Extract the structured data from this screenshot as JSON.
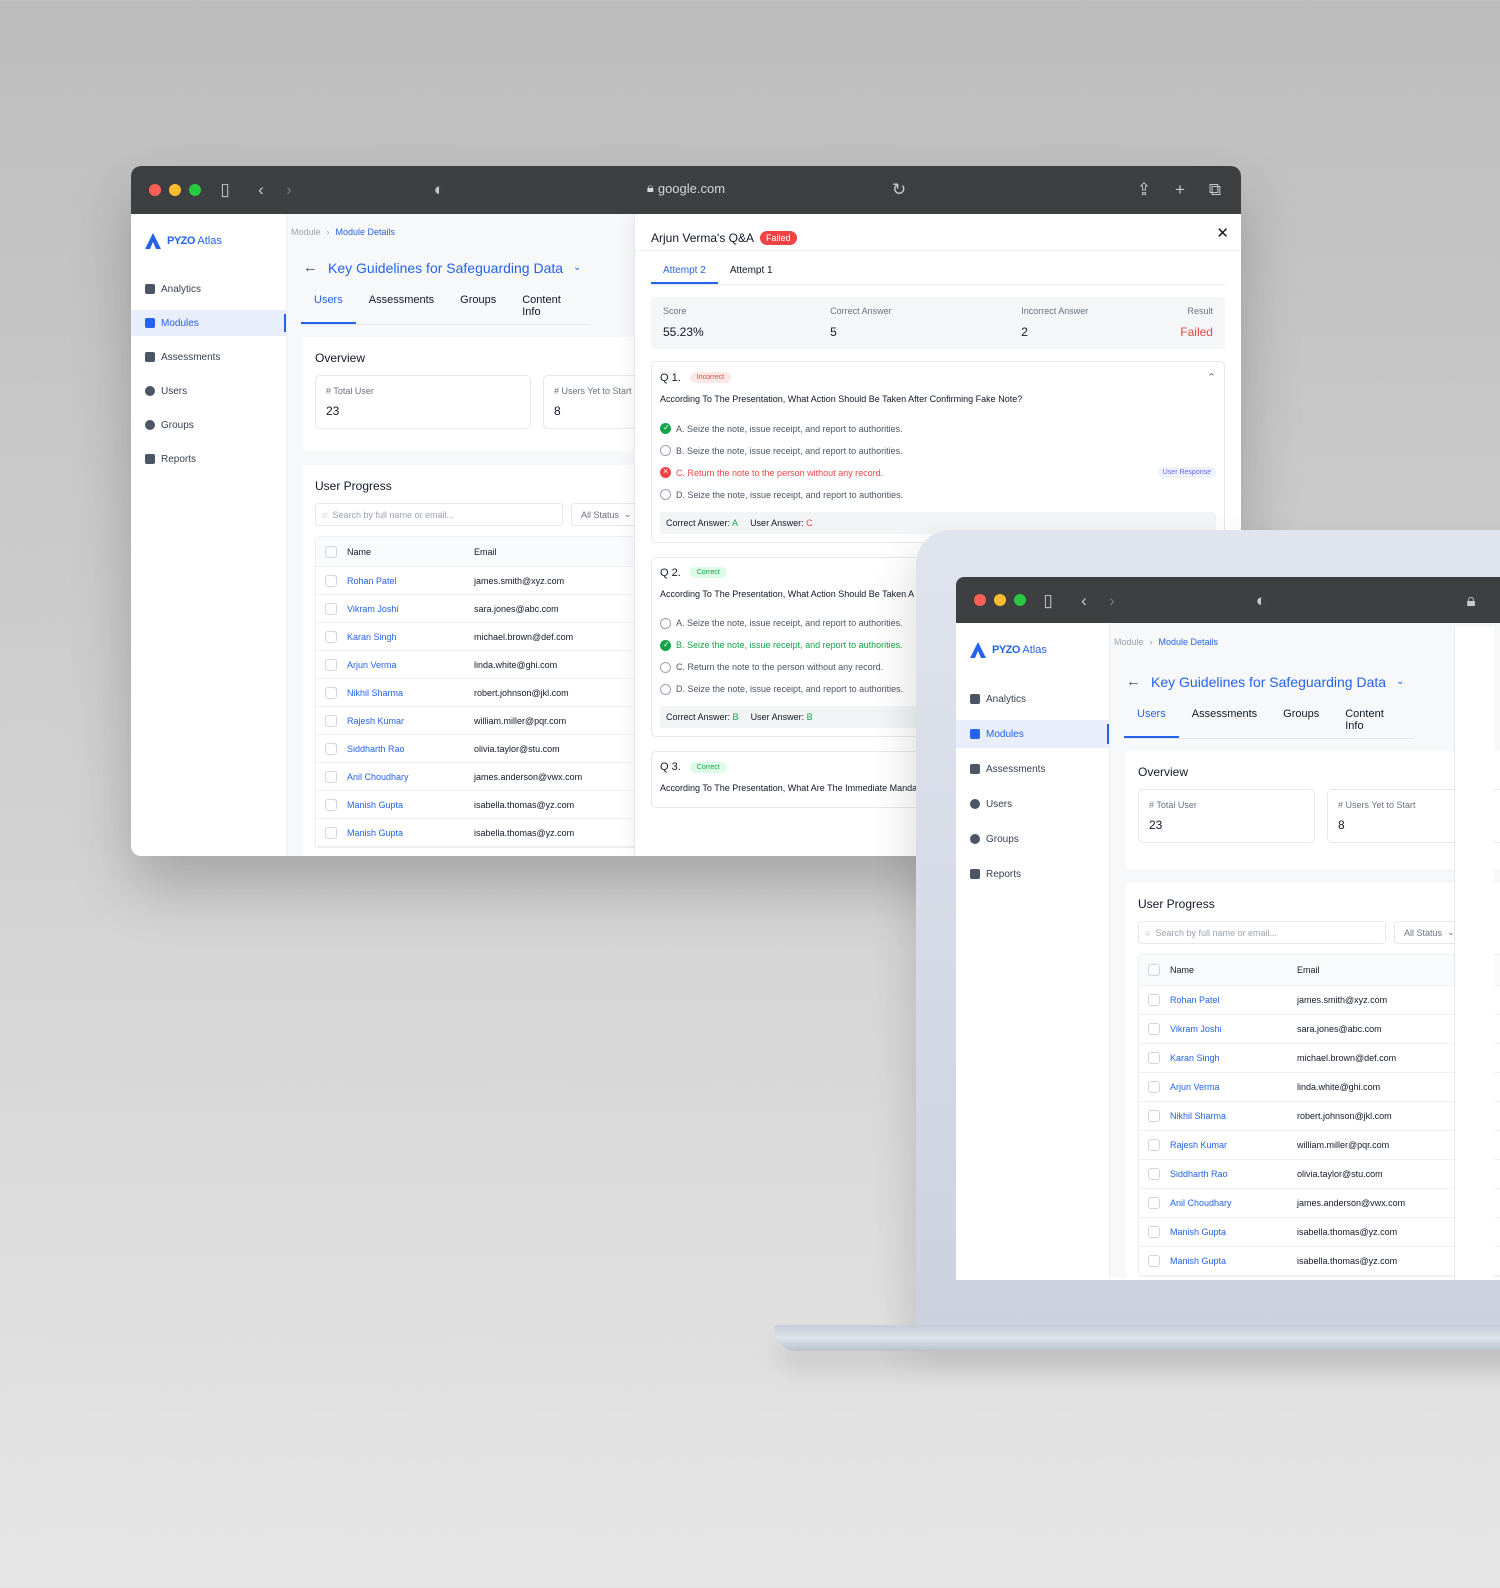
{
  "browser": {
    "url": "google.com"
  },
  "app": {
    "logo_text_bold": "PYZO",
    "logo_text": "Atlas"
  },
  "sidebar": {
    "items": [
      {
        "label": "Analytics"
      },
      {
        "label": "Modules"
      },
      {
        "label": "Assessments"
      },
      {
        "label": "Users"
      },
      {
        "label": "Groups"
      },
      {
        "label": "Reports"
      }
    ]
  },
  "breadcrumb": {
    "parent": "Module",
    "current": "Module Details"
  },
  "page": {
    "title": "Key Guidelines for Safeguarding Data",
    "tabs": [
      "Users",
      "Assessments",
      "Groups",
      "Content Info"
    ]
  },
  "overview": {
    "title": "Overview",
    "stats": [
      {
        "label": "# Total User",
        "value": "23"
      },
      {
        "label": "# Users Yet to Start",
        "value": "8"
      }
    ]
  },
  "progress": {
    "title": "User Progress",
    "search_placeholder": "Search by full name or email...",
    "status_filter": "All Status",
    "columns": [
      "Name",
      "Email"
    ],
    "rows": [
      {
        "name": "Rohan Patel",
        "email": "james.smith@xyz.com"
      },
      {
        "name": "Vikram Joshi",
        "email": "sara.jones@abc.com"
      },
      {
        "name": "Karan Singh",
        "email": "michael.brown@def.com"
      },
      {
        "name": "Arjun Verma",
        "email": "linda.white@ghi.com"
      },
      {
        "name": "Nikhil Sharma",
        "email": "robert.johnson@jkl.com"
      },
      {
        "name": "Rajesh Kumar",
        "email": "william.miller@pqr.com"
      },
      {
        "name": "Siddharth Rao",
        "email": "olivia.taylor@stu.com"
      },
      {
        "name": "Anil Choudhary",
        "email": "james.anderson@vwx.com"
      },
      {
        "name": "Manish Gupta",
        "email": "isabella.thomas@yz.com"
      },
      {
        "name": "Manish Gupta",
        "email": "isabella.thomas@yz.com"
      }
    ]
  },
  "qa": {
    "title": "Arjun Verma's Q&A",
    "status": "Failed",
    "attempts": [
      "Attempt 2",
      "Attempt 1"
    ],
    "summary": {
      "score_label": "Score",
      "score": "55.23%",
      "correct_label": "Correct Answer",
      "correct": "5",
      "incorrect_label": "Incorrect Answer",
      "incorrect": "2",
      "result_label": "Result",
      "result": "Failed"
    },
    "questions": [
      {
        "num": "Q 1.",
        "status": "Incorrect",
        "text": "According To The Presentation, What Action Should Be Taken After Confirming Fake Note?",
        "options": [
          "A. Seize the note, issue receipt, and report to authorities.",
          "B. Seize the note, issue receipt, and report to authorities.",
          "C. Return the note to the person without any record.",
          "D. Seize the note, issue receipt, and report to authorities."
        ],
        "user_response_tag": "User Response",
        "correct_label": "Correct Answer:",
        "correct": "A",
        "user_label": "User Answer:",
        "user": "C"
      },
      {
        "num": "Q 2.",
        "status": "Correct",
        "text": "According To The Presentation, What Action Should Be Taken A",
        "options": [
          "A. Seize the note, issue receipt, and report to authorities.",
          "B. Seize the note, issue receipt, and report to authorities.",
          "C. Return the note to the person without any record.",
          "D. Seize the note, issue receipt, and report to authorities."
        ],
        "correct_label": "Correct Answer:",
        "correct": "B",
        "user_label": "User Answer:",
        "user": "B"
      },
      {
        "num": "Q 3.",
        "status": "Correct",
        "text": "According To The Presentation, What Are The Immediate Manda Counterfeit?"
      }
    ]
  },
  "colors": {
    "accent": "#2563eb",
    "success": "#16a34a",
    "danger": "#ef4444"
  }
}
